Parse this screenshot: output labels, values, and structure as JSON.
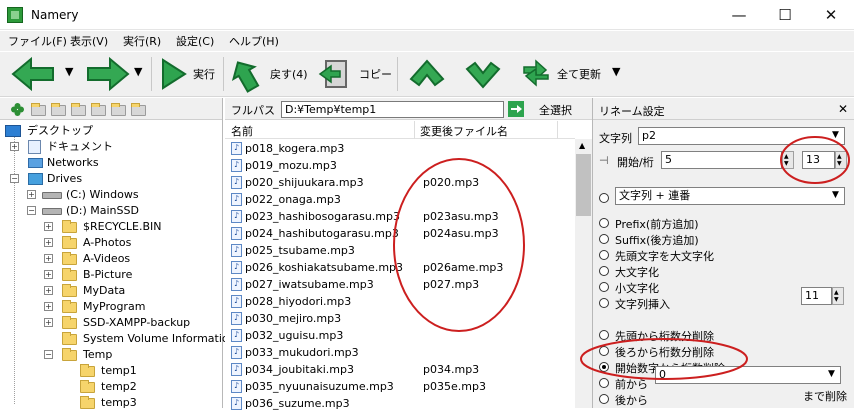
{
  "window": {
    "title": "Namery",
    "minimize_symbol": "—",
    "maximize_symbol": "☐",
    "close_symbol": "✕"
  },
  "menu": [
    "ファイル(F)",
    "表示(V)",
    "実行(R)",
    "設定(C)",
    "ヘルプ(H)"
  ],
  "toolbar": {
    "execute_label": "実行",
    "back_label": "戻す(4)",
    "copy_label": "コピー",
    "refresh_all_label": "全て更新",
    "back_icon": "arrow-left-icon",
    "forward_icon": "arrow-right-icon",
    "colors": {
      "arrow": "#34a853",
      "dark": "#136c2d"
    }
  },
  "tree": {
    "items": [
      {
        "label": "デスクトップ"
      },
      {
        "label": "ドキュメント"
      },
      {
        "label": "Networks"
      },
      {
        "label": "Drives"
      },
      {
        "label": "(C:) Windows"
      },
      {
        "label": "(D:) MainSSD"
      },
      {
        "label": "$RECYCLE.BIN"
      },
      {
        "label": "A-Photos"
      },
      {
        "label": "A-Videos"
      },
      {
        "label": "B-Picture"
      },
      {
        "label": "MyData"
      },
      {
        "label": "MyProgram"
      },
      {
        "label": "SSD-XAMPP-backup"
      },
      {
        "label": "System Volume Information"
      },
      {
        "label": "Temp"
      },
      {
        "label": "temp1"
      },
      {
        "label": "temp2"
      },
      {
        "label": "temp3"
      }
    ]
  },
  "path": {
    "label": "フルパス",
    "value": "D:¥Temp¥temp1",
    "select_all_label": "全選択"
  },
  "files": {
    "columns": [
      "名前",
      "変更後ファイル名"
    ],
    "rows": [
      {
        "name": "p018_kogera.mp3",
        "new_name": ""
      },
      {
        "name": "p019_mozu.mp3",
        "new_name": ""
      },
      {
        "name": "p020_shijuukara.mp3",
        "new_name": "p020.mp3"
      },
      {
        "name": "p022_onaga.mp3",
        "new_name": ""
      },
      {
        "name": "p023_hashibosogarasu.mp3",
        "new_name": "p023asu.mp3"
      },
      {
        "name": "p024_hashibutogarasu.mp3",
        "new_name": "p024asu.mp3"
      },
      {
        "name": "p025_tsubame.mp3",
        "new_name": ""
      },
      {
        "name": "p026_koshiakatsubame.mp3",
        "new_name": "p026ame.mp3"
      },
      {
        "name": "p027_iwatsubame.mp3",
        "new_name": "p027.mp3"
      },
      {
        "name": "p028_hiyodori.mp3",
        "new_name": ""
      },
      {
        "name": "p030_mejiro.mp3",
        "new_name": ""
      },
      {
        "name": "p032_uguisu.mp3",
        "new_name": ""
      },
      {
        "name": "p033_mukudori.mp3",
        "new_name": ""
      },
      {
        "name": "p034_joubitaki.mp3",
        "new_name": "p034.mp3"
      },
      {
        "name": "p035_nyuunaisuzume.mp3",
        "new_name": "p035e.mp3"
      },
      {
        "name": "p036_suzume.mp3",
        "new_name": ""
      }
    ]
  },
  "rename": {
    "title": "リネーム設定",
    "close_symbol": "✕",
    "string_label": "文字列",
    "string_value": "p2",
    "start_label": "開始/桁",
    "start_value": "5",
    "digits_value": "13",
    "top_combo": "文字列 + 連番",
    "options": [
      {
        "label": "Prefix(前方追加)",
        "selected": false
      },
      {
        "label": "Suffix(後方追加)",
        "selected": false
      },
      {
        "label": "先頭文字を大文字化",
        "selected": false
      },
      {
        "label": "大文字化",
        "selected": false
      },
      {
        "label": "小文字化",
        "selected": false
      },
      {
        "label": "文字列挿入",
        "selected": false
      },
      {
        "label": "先頭から桁数分削除",
        "selected": false
      },
      {
        "label": "後ろから桁数分削除",
        "selected": false
      },
      {
        "label": "開始数字から桁数削除",
        "selected": true
      },
      {
        "label": "前から",
        "selected": false
      },
      {
        "label": "後から",
        "selected": false
      }
    ],
    "insert_value": "11",
    "front_value": "0",
    "until_delete_label": "まで削除"
  }
}
